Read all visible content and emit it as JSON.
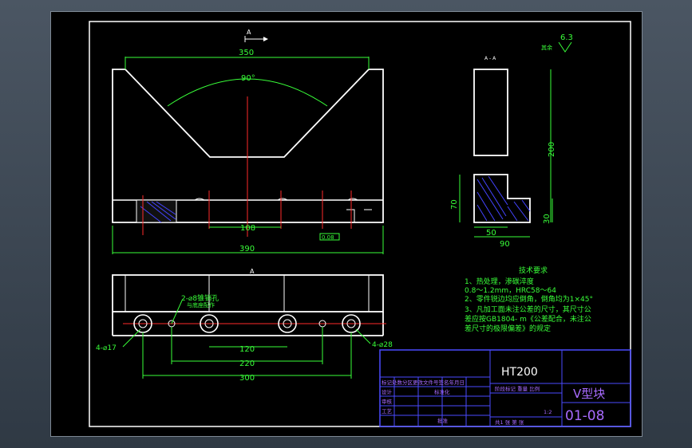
{
  "drawing": {
    "section_mark_main": "A",
    "section_mark_bottom": "A",
    "section_view_label": "A - A",
    "roughness_prefix": "其余",
    "roughness_value": "6.3"
  },
  "dimensions": {
    "top_width": "350",
    "v_angle": "90°",
    "slot_width": "108",
    "overall_width": "390",
    "flatness": "0.08",
    "section_height": "200",
    "section_lower": "70",
    "section_foot": "30",
    "section_50": "50",
    "section_90": "90",
    "hole_label_small": "2-⌀8锥销孔",
    "hole_label_small_note": "与底座配作",
    "hole_label_17": "4-⌀17",
    "hole_label_28": "4-⌀28",
    "dim_120": "120",
    "dim_220": "220",
    "dim_300": "300"
  },
  "technical_requirements": {
    "heading": "技术要求",
    "lines": [
      "1、热处理，渗碳淬度",
      "0.8～1.2mm，HRC58～64",
      "2、零件锐边均应倒角，倒角均为1×45°",
      "3、凡加工面未注公差的尺寸，其尺寸公",
      "差应按GB1804-  m《公差配合，未注公",
      "差尺寸的极限偏差》的规定"
    ]
  },
  "title_block": {
    "material": "HT200",
    "part_name": "V型块",
    "drawing_number": "01-08",
    "scale": "1:2",
    "header_row": "标记处数分区更改文件号签名年月日",
    "row_design": "设计",
    "row_std": "标准化",
    "row_check": "审核",
    "row_process": "工艺",
    "row_approve": "批准",
    "stage_row": "阶段标记 重量 比例",
    "sheet_row": "共1 张 第 张"
  },
  "colors": {
    "outline": "#ffffff",
    "dimension": "#39ff39",
    "centerline": "#ff2a2a",
    "hatch": "#4444ff",
    "titleblock": "#4a4aff",
    "titletext": "#a86bff"
  }
}
